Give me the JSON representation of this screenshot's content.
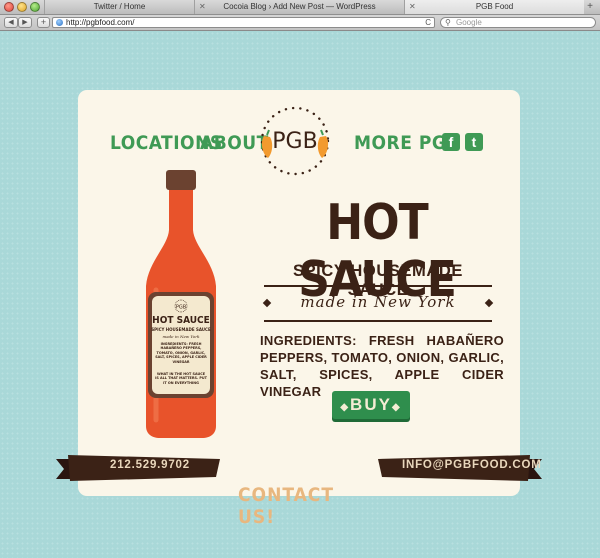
{
  "browser": {
    "tabs": [
      {
        "label": "Twitter / Home"
      },
      {
        "label": "Cocoia Blog › Add New Post — WordPress"
      },
      {
        "label": "PGB Food"
      }
    ],
    "new_tab": "+",
    "url": "http://pgbfood.com/",
    "search_placeholder": "Google",
    "reload": "C",
    "back": "◀",
    "forward": "▶",
    "add": "+"
  },
  "nav": {
    "locations": "LOCATIONS",
    "about": "ABOUT",
    "logo": "PGB",
    "more": "MORE PGB",
    "facebook": "f",
    "twitter": "t"
  },
  "product": {
    "title": "HOT SAUCE",
    "subtitle": "SPICY HOUSEMADE SAUCE",
    "made_in": "made in New York",
    "ingredients": "INGREDIENTS: FRESH HABAÑERO PEPPERS, TOMATO, ONION, GARLIC, SALT, SPICES, APPLE CIDER VINEGAR",
    "buy": "BUY"
  },
  "bottle_label": {
    "brand": "PGB",
    "title": "HOT SAUCE",
    "subtitle": "SPICY HOUSEMADE SAUCE",
    "made_in": "made in New York",
    "ingredients": "INGREDIENTS: FRESH HABAÑERO PEPPERS, TOMATO, ONION, GARLIC, SALT, SPICES, APPLE CIDER VINEGAR",
    "quote": "WHAT IN THE HOT SAUCE IS ALL THAT MATTERS. PUT IT ON EVERYTHING"
  },
  "footer": {
    "phone": "212.529.9702",
    "contact": "CONTACT US!",
    "email": "INFO@PGBFOOD.COM"
  },
  "colors": {
    "background": "#a9d8d8",
    "card": "#fbf6e9",
    "green": "#3f9a55",
    "brown": "#3b2216",
    "sauce": "#e8532b",
    "contact": "#e8b77f"
  }
}
